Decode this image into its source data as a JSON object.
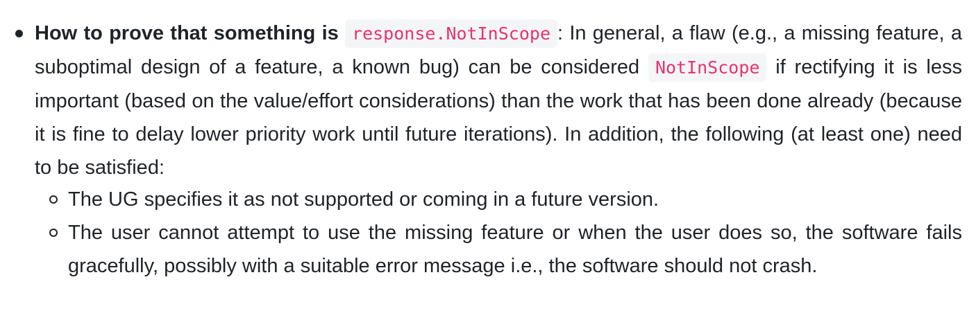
{
  "item": {
    "heading": "How to prove that something is",
    "heading_code": "response.NotInScope",
    "colon": ":",
    "text_1": "In general, a flaw (e.g., a missing feature, a suboptimal design of a feature, a known bug) can be considered",
    "inline_code": "NotInScope",
    "text_2": "if rectifying it is less important (based on the value/effort considerations) than the work that has been done already (because it is fine to delay lower priority work until future iterations). In addition, the following (at least one) need to be satisfied:"
  },
  "sub_items": [
    "The UG specifies it as not supported or coming in a future version.",
    "The user cannot attempt to use the missing feature or when the user does so, the software fails gracefully, possibly with a suitable error message i.e., the software should not crash."
  ]
}
